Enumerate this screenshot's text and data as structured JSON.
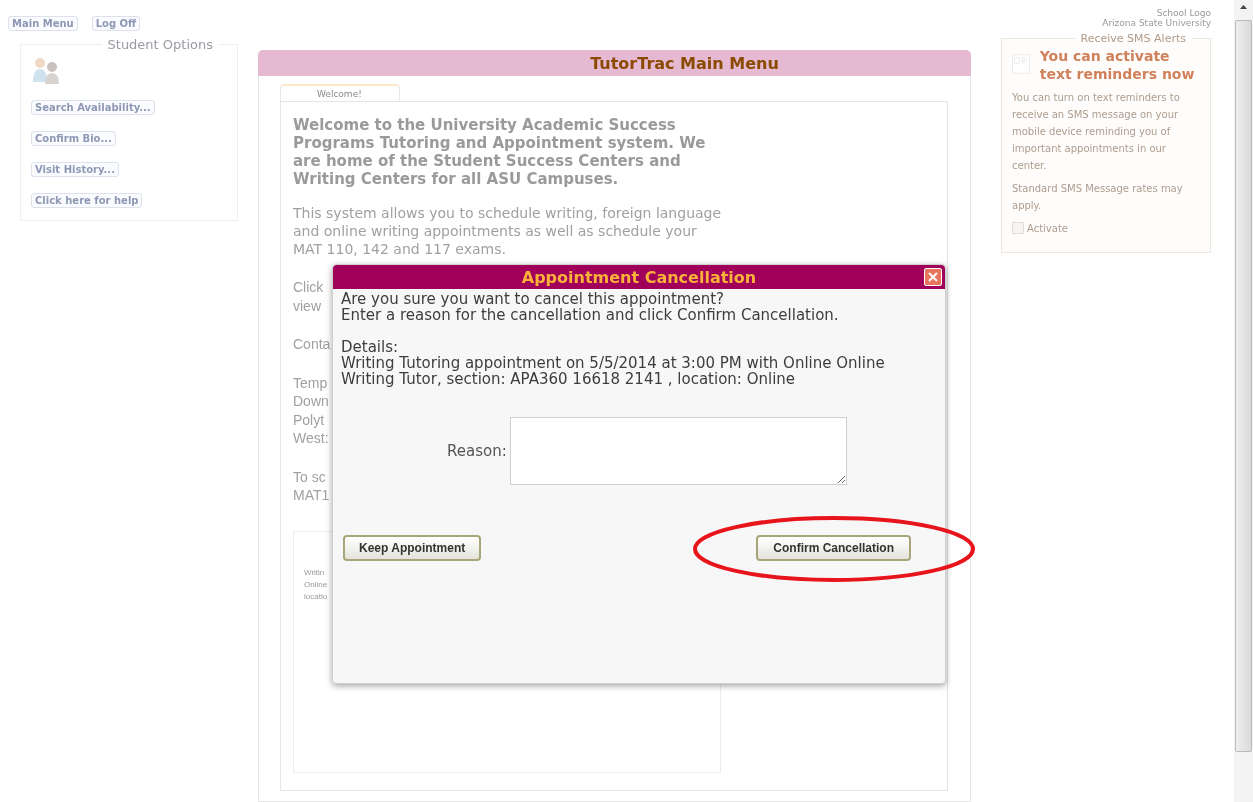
{
  "top_buttons": [
    "Main Menu",
    "Log Off"
  ],
  "student_options": {
    "title": "Student Options",
    "buttons": [
      "Search Availability...",
      "Confirm Bio...",
      "Visit History...",
      "Click here for help"
    ]
  },
  "main_menu": {
    "title": "TutorTrac Main Menu",
    "tabs": [
      {
        "label": "Welcome!",
        "selected": true
      }
    ],
    "heading": "Welcome to the University Academic Success Programs Tutoring and Appointment system. We are home of the Student Success Centers and Writing Centers for all ASU Campuses.",
    "intro": "This system allows you to schedule writing, foreign language and online writing appointments as well as schedule your MAT 110, 142 and 117 exams.",
    "partial_groups": [
      [
        "Click",
        "view"
      ],
      [
        "Conta"
      ],
      [
        "Temp",
        "Down",
        "Polyt",
        "West:"
      ],
      [
        "To sc",
        "MAT1"
      ]
    ],
    "box_lines": [
      "Writin",
      "Online",
      "locatio"
    ]
  },
  "school": {
    "logo_text": "School Logo",
    "name": "Arizona State University"
  },
  "sms": {
    "title": "Receive SMS Alerts",
    "heading": "You can activate text reminders now",
    "body": "You can turn on text reminders to receive an SMS message on your mobile device reminding you of important appointments in our center.",
    "note": "Standard SMS Message rates may apply.",
    "activate": {
      "label": "Activate",
      "checked": false
    }
  },
  "dialog": {
    "title": "Appointment Cancellation",
    "message": [
      "Are you sure you want to cancel this appointment?",
      "Enter a reason for the cancellation and click Confirm Cancellation."
    ],
    "details_label": "Details:",
    "details": [
      "Writing Tutoring appointment on 5/5/2014 at 3:00 PM with Online Online",
      "Writing Tutor, section: APA360 16618 2141 , location: Online"
    ],
    "reason_label": "Reason:",
    "buttons": [
      {
        "label": "Keep Appointment",
        "highlighted": false
      },
      {
        "label": "Confirm Cancellation",
        "highlighted": true
      }
    ]
  }
}
